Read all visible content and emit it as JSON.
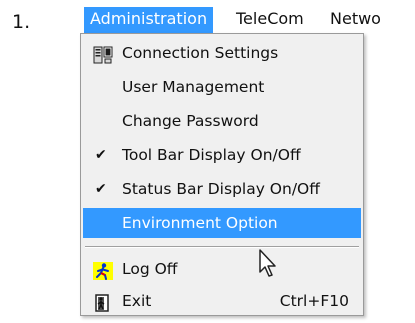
{
  "step": {
    "number": "1."
  },
  "menubar": {
    "items": [
      {
        "label": "Administration",
        "active": true
      },
      {
        "label": "TeleCom",
        "active": false
      },
      {
        "label": "Netwo",
        "active": false
      }
    ]
  },
  "dropdown": {
    "items": [
      {
        "label": "Connection Settings",
        "icon": "connection-settings-icon"
      },
      {
        "label": "User Management"
      },
      {
        "label": "Change Password"
      },
      {
        "label": "Tool Bar Display On/Off",
        "checked": true
      },
      {
        "label": "Status Bar Display On/Off",
        "checked": true
      },
      {
        "label": "Environment Option",
        "highlighted": true
      },
      {
        "label": "Log Off",
        "icon": "log-off-icon"
      },
      {
        "label": "Exit",
        "icon": "exit-icon",
        "shortcut": "Ctrl+F10"
      }
    ]
  },
  "colors": {
    "highlight": "#3399ff",
    "menu_background": "#f0f0f0",
    "menu_border": "#9a9a9a"
  }
}
